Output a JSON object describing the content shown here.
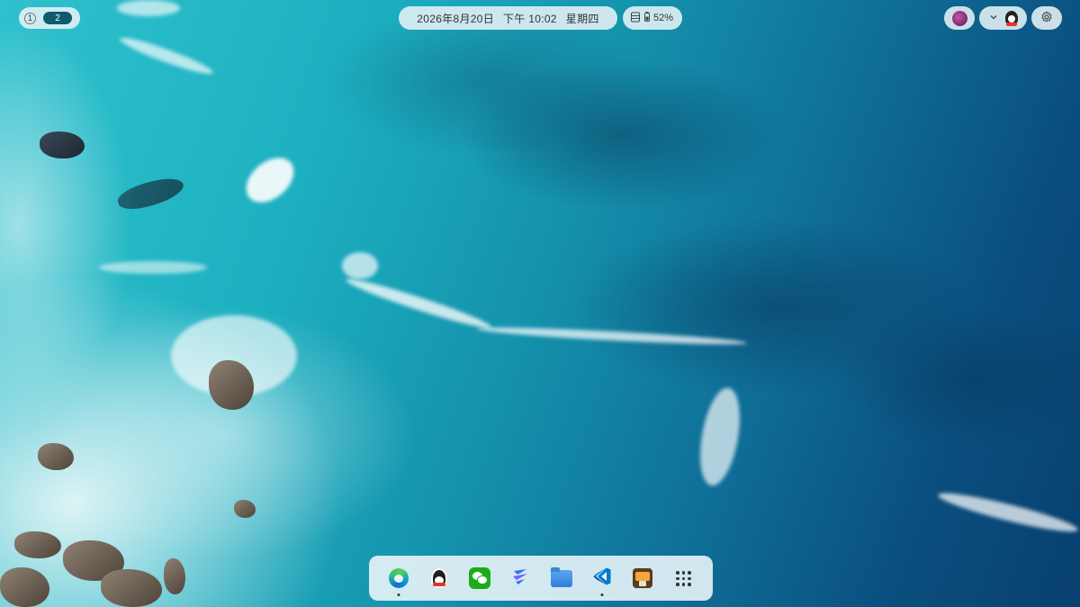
{
  "workspaces": {
    "items": [
      "1",
      "2"
    ],
    "active": "2"
  },
  "clock": {
    "date": "2026年8月20日",
    "time": "下午 10:02",
    "weekday": "星期四"
  },
  "status": {
    "battery_percent": "52%"
  },
  "icons": {
    "workspace_switcher": "workspace-switcher",
    "storage": "storage-icon",
    "battery": "battery-icon",
    "user": "user-avatar-icon",
    "tray_expand": "chevron-down-icon",
    "tray_qq": "qq-tray-icon",
    "settings": "gear-icon"
  },
  "dock": {
    "apps": [
      {
        "name": "microsoft-edge",
        "running": true
      },
      {
        "name": "qq",
        "running": false
      },
      {
        "name": "wechat",
        "running": false
      },
      {
        "name": "feishu",
        "running": false
      },
      {
        "name": "file-manager",
        "running": false
      },
      {
        "name": "visual-studio-code",
        "running": true
      },
      {
        "name": "game",
        "running": false
      },
      {
        "name": "app-grid",
        "running": false
      }
    ]
  },
  "colors": {
    "active_workspace": "#0d5c6e",
    "panel_bg": "#e6f2f6",
    "wechat_green": "#1aad19",
    "vscode_blue": "#007acc"
  }
}
